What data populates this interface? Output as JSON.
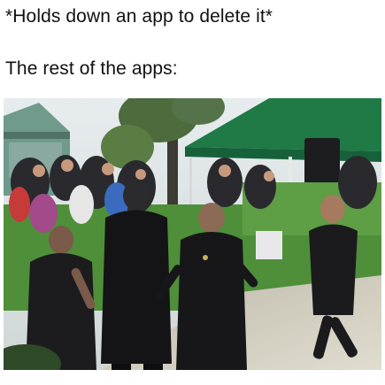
{
  "caption": {
    "line1": "*Holds down an app to delete it*",
    "line2": "The rest of the apps:"
  },
  "colors": {
    "background": "#ffffff",
    "text": "#111111",
    "tent_green": "#1f7a45",
    "grass": "#4f8f3a",
    "sidewalk": "#c9c6b8",
    "crowd_dark": "#1a1a1c"
  },
  "photo": {
    "subject": "outdoor crowd scene with police officers dancing under a green canopy tent"
  }
}
